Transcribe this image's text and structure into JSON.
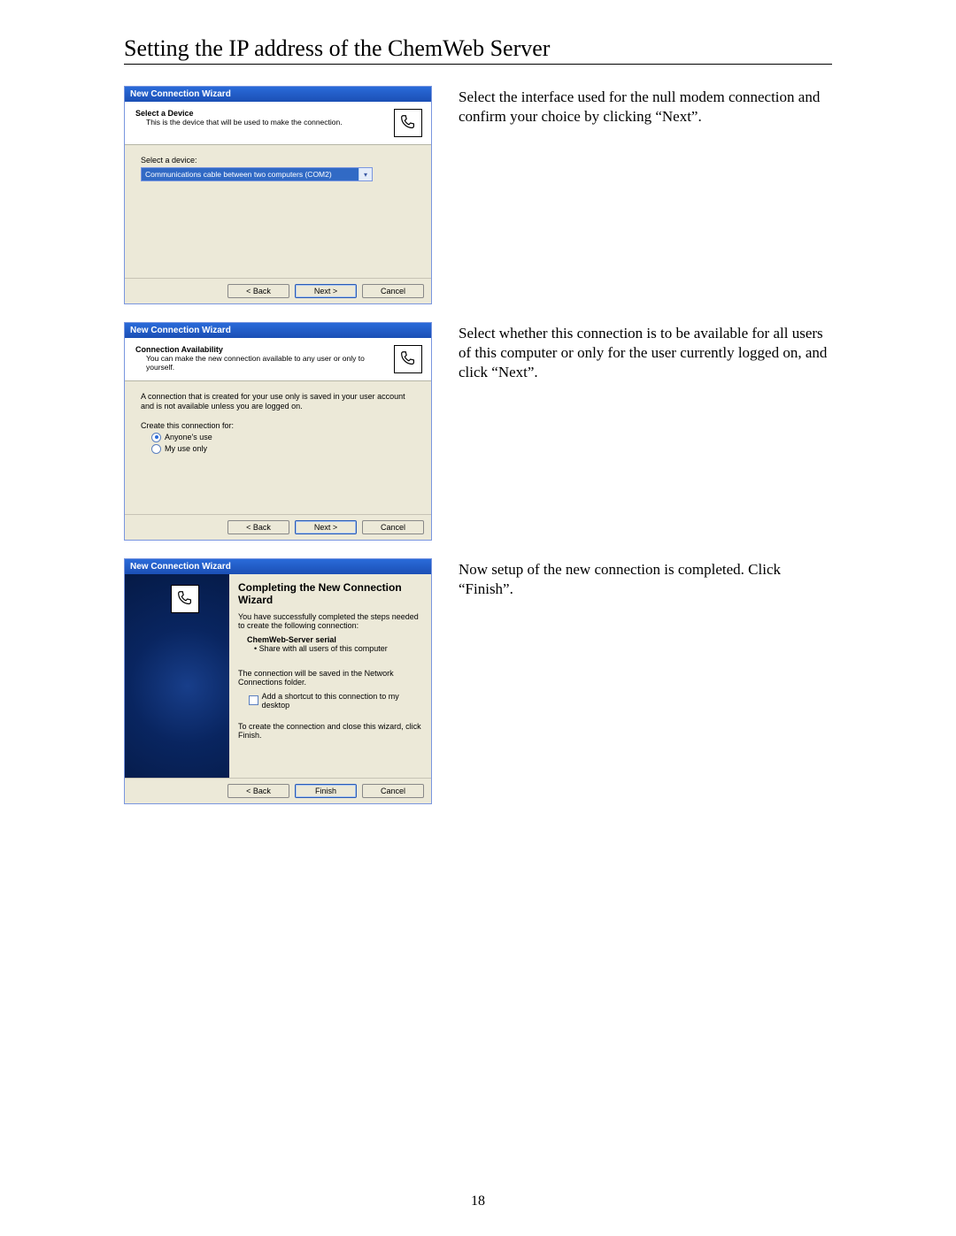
{
  "page_title": "Setting the IP address of the ChemWeb Server",
  "page_number": "18",
  "row1": {
    "desc": "Select the interface used for the null modem connection and confirm your choice by clicking “Next”.",
    "wizard_title": "New Connection Wizard",
    "header_bold": "Select a Device",
    "header_sub": "This is the device that will be used to make the connection.",
    "body_label": "Select a device:",
    "combo_value": "Communications cable between two computers (COM2)",
    "btn_back": "< Back",
    "btn_next": "Next >",
    "btn_cancel": "Cancel"
  },
  "row2": {
    "desc": "Select whether this connection is to be available for all users of this computer or only for the user currently logged on, and click “Next”.",
    "wizard_title": "New Connection Wizard",
    "header_bold": "Connection Availability",
    "header_sub": "You can make the new connection available to any user or only to yourself.",
    "body_text": "A connection that is created for your use only is saved in your user account and is not available unless you are logged on.",
    "create_label": "Create this connection for:",
    "opt_anyone": "Anyone's use",
    "opt_myuse": "My use only",
    "btn_back": "< Back",
    "btn_next": "Next >",
    "btn_cancel": "Cancel"
  },
  "row3": {
    "desc": "Now setup of the new connection is completed. Click “Finish”.",
    "wizard_title": "New Connection Wizard",
    "complete_title": "Completing the New Connection Wizard",
    "complete_sub": "You have successfully completed the steps needed to create the following connection:",
    "conn_name": "ChemWeb-Server serial",
    "conn_bullet": "Share with all users of this computer",
    "saved_line": "The connection will be saved in the Network Connections folder.",
    "shortcut_label": "Add a shortcut to this connection to my desktop",
    "finish_hint": "To create the connection and close this wizard, click Finish.",
    "btn_back": "< Back",
    "btn_finish": "Finish",
    "btn_cancel": "Cancel"
  }
}
